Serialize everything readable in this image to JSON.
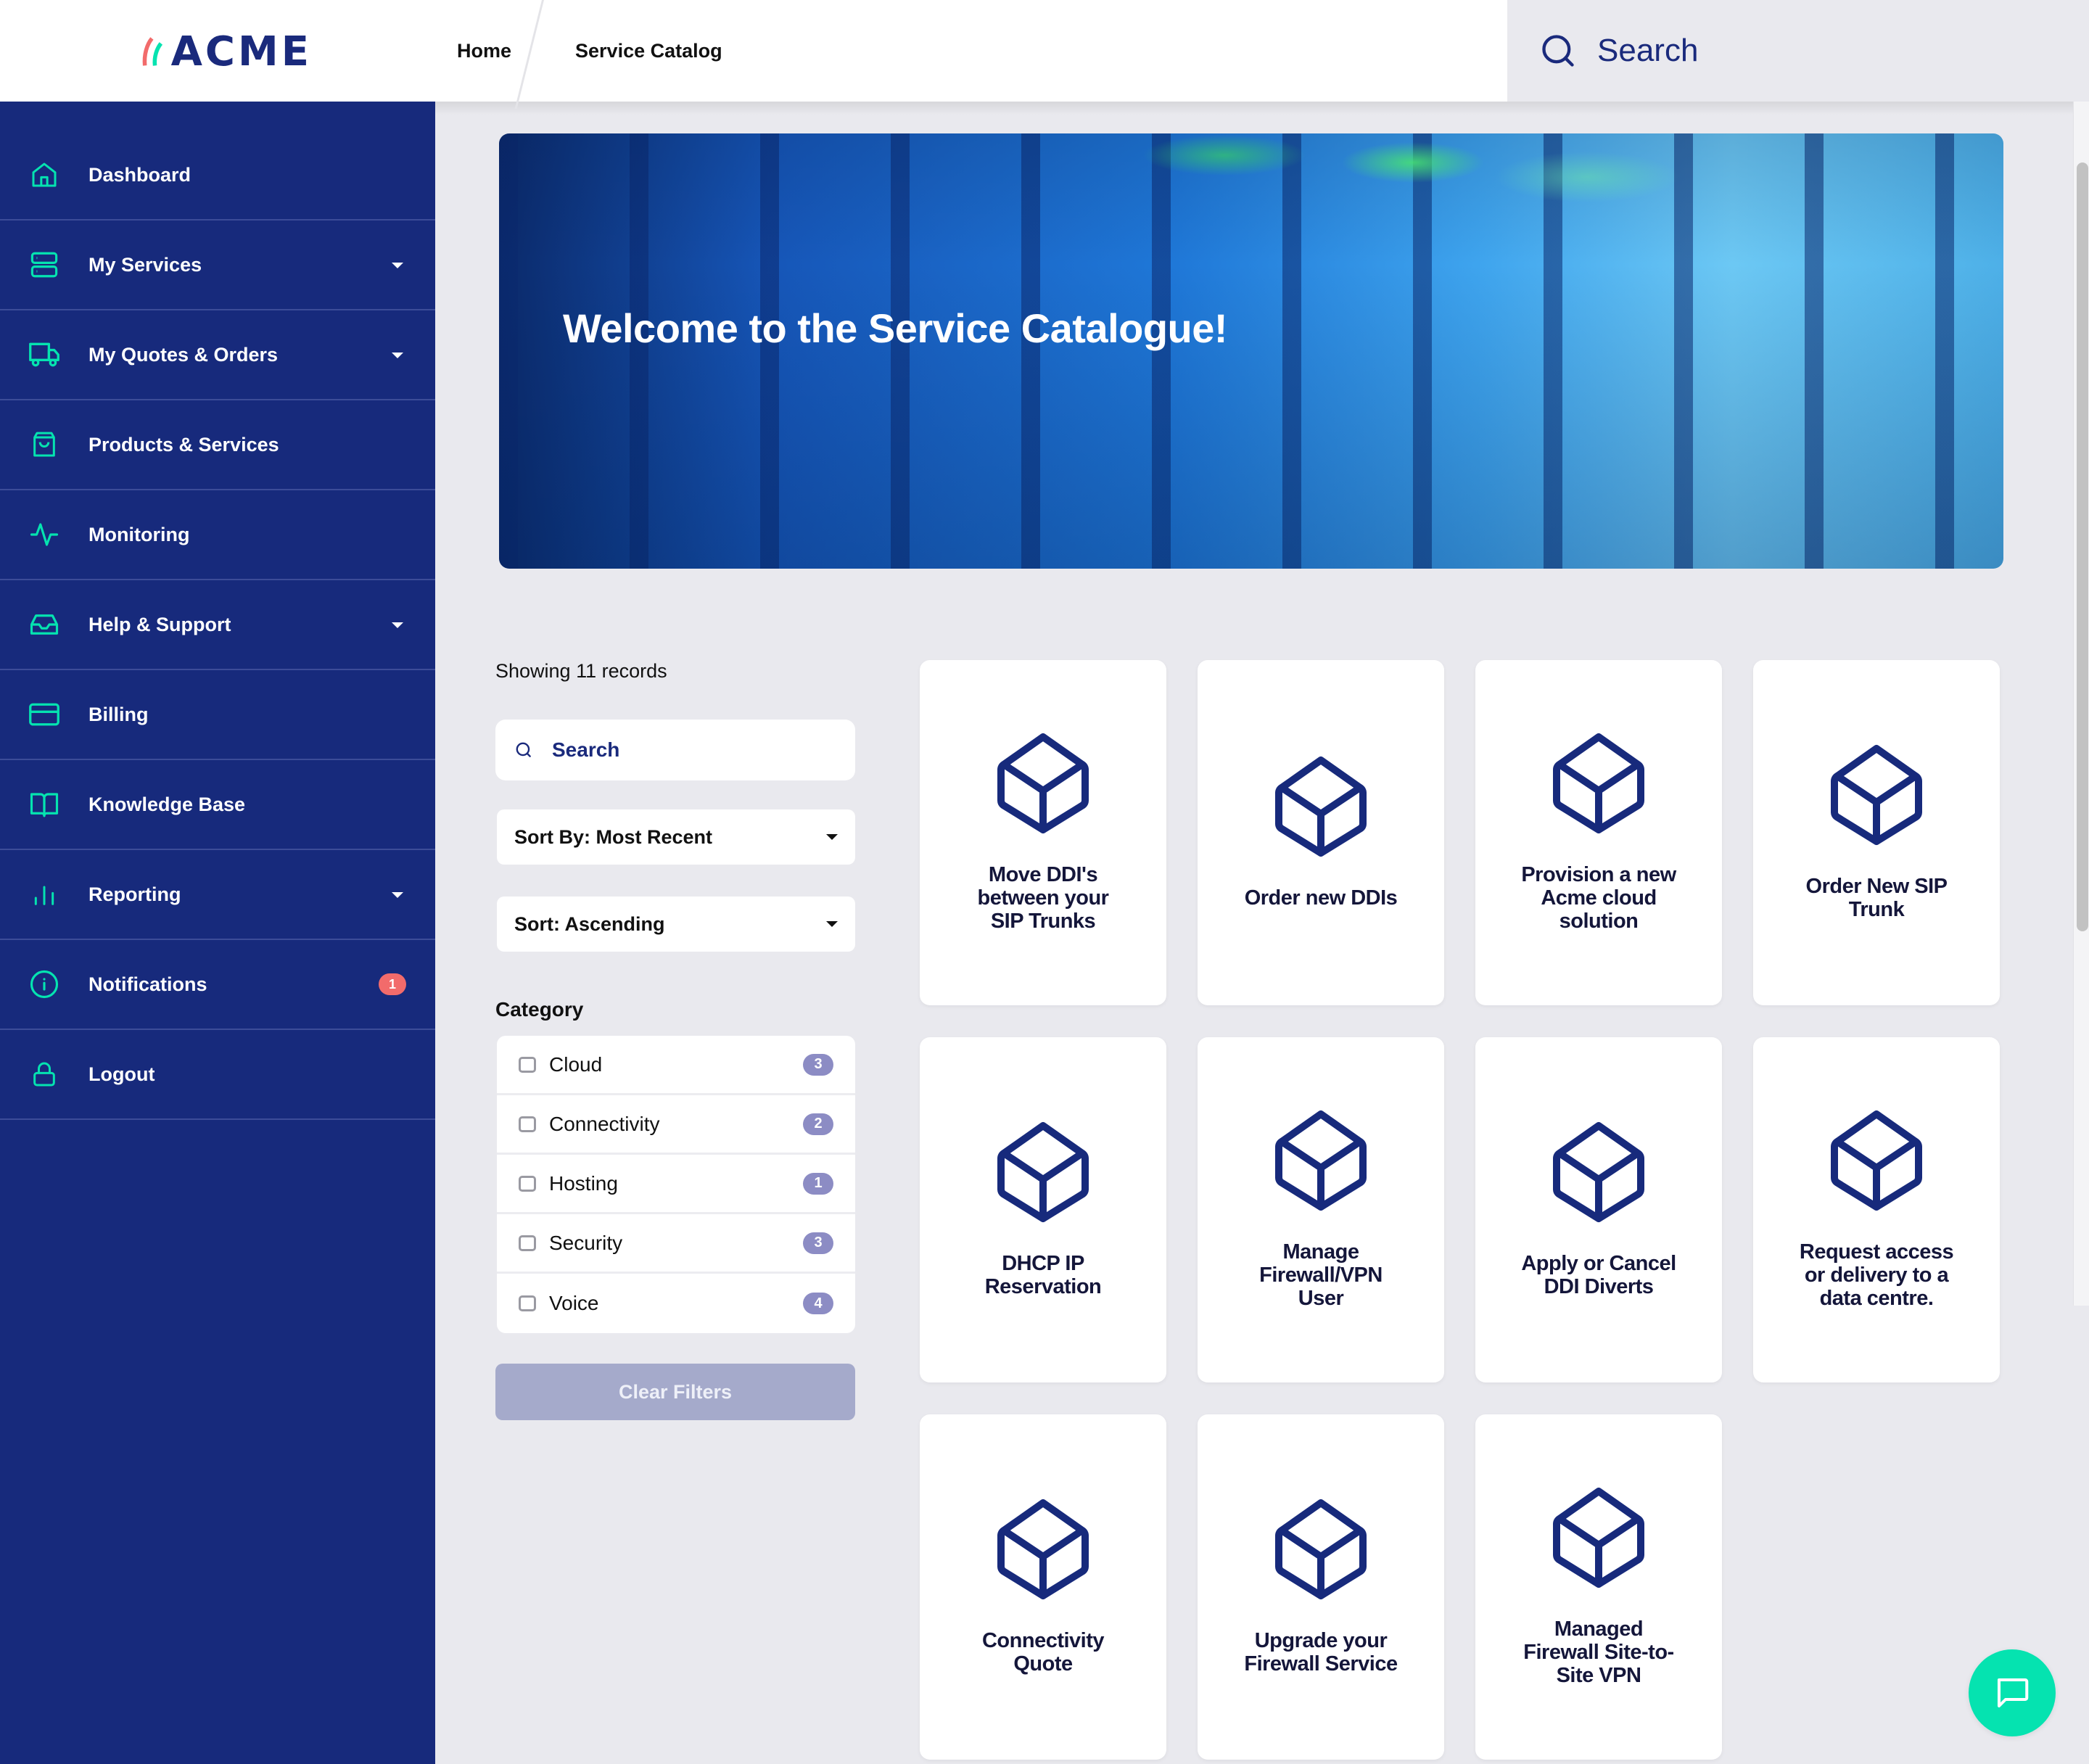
{
  "header": {
    "logo_text": "ACME",
    "breadcrumb": [
      {
        "label": "Home"
      },
      {
        "label": "Service Catalog"
      }
    ],
    "search_placeholder": "Search",
    "avatar_icon": "user-avatar"
  },
  "sidebar": {
    "items": [
      {
        "label": "Dashboard",
        "icon": "home-icon",
        "has_dropdown": false
      },
      {
        "label": "My Services",
        "icon": "server-icon",
        "has_dropdown": true
      },
      {
        "label": "My Quotes & Orders",
        "icon": "truck-icon",
        "has_dropdown": true
      },
      {
        "label": "Products & Services",
        "icon": "shopping-bag-icon",
        "has_dropdown": false
      },
      {
        "label": "Monitoring",
        "icon": "activity-icon",
        "has_dropdown": false
      },
      {
        "label": "Help & Support",
        "icon": "inbox-icon",
        "has_dropdown": true
      },
      {
        "label": "Billing",
        "icon": "credit-card-icon",
        "has_dropdown": false
      },
      {
        "label": "Knowledge Base",
        "icon": "book-open-icon",
        "has_dropdown": false
      },
      {
        "label": "Reporting",
        "icon": "bar-chart-icon",
        "has_dropdown": true
      },
      {
        "label": "Notifications",
        "icon": "info-icon",
        "has_dropdown": false,
        "badge": "1"
      },
      {
        "label": "Logout",
        "icon": "lock-icon",
        "has_dropdown": false
      }
    ]
  },
  "hero": {
    "title": "Welcome to the Service Catalogue!"
  },
  "filters": {
    "records_text": "Showing 11 records",
    "search_placeholder": "Search",
    "sort_by": "Sort By: Most Recent",
    "sort_order": "Sort: Ascending",
    "category_title": "Category",
    "categories": [
      {
        "label": "Cloud",
        "count": "3",
        "checked": false
      },
      {
        "label": "Connectivity",
        "count": "2",
        "checked": false
      },
      {
        "label": "Hosting",
        "count": "1",
        "checked": false
      },
      {
        "label": "Security",
        "count": "3",
        "checked": false
      },
      {
        "label": "Voice",
        "count": "4",
        "checked": false
      }
    ],
    "clear_label": "Clear Filters"
  },
  "catalog": {
    "items": [
      {
        "title": "Move DDI's between your SIP Trunks",
        "icon": "box-icon"
      },
      {
        "title": "Order new DDIs",
        "icon": "box-icon"
      },
      {
        "title": "Provision a new Acme cloud solution",
        "icon": "box-icon"
      },
      {
        "title": "Order New SIP Trunk",
        "icon": "box-icon"
      },
      {
        "title": "DHCP IP Reservation",
        "icon": "box-icon"
      },
      {
        "title": "Manage Firewall/VPN User",
        "icon": "box-icon"
      },
      {
        "title": "Apply or Cancel DDI Diverts",
        "icon": "box-icon"
      },
      {
        "title": "Request access or delivery to a data centre.",
        "icon": "box-icon"
      },
      {
        "title": "Connectivity Quote",
        "icon": "box-icon"
      },
      {
        "title": "Upgrade your Firewall Service",
        "icon": "box-icon"
      },
      {
        "title": "Managed Firewall Site-to-Site VPN",
        "icon": "box-icon"
      }
    ]
  },
  "colors": {
    "brand_navy": "#172a7c",
    "accent_teal": "#05e3b0",
    "logo_coral": "#f26b6b",
    "badge_red": "#f26b6b",
    "count_badge": "#8c8cc4",
    "clear_button": "#a5aacb"
  }
}
